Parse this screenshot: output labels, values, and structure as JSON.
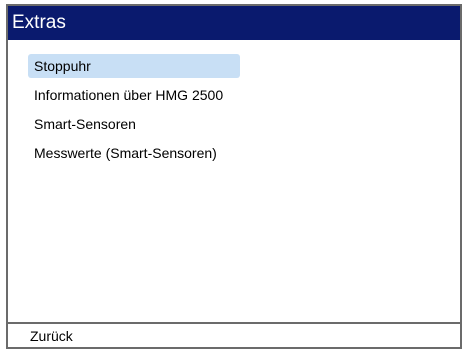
{
  "window": {
    "title": "Extras"
  },
  "menu": {
    "items": [
      {
        "label": "Stoppuhr",
        "selected": true
      },
      {
        "label": "Informationen über HMG 2500",
        "selected": false
      },
      {
        "label": "Smart-Sensoren",
        "selected": false
      },
      {
        "label": "Messwerte (Smart-Sensoren)",
        "selected": false
      }
    ]
  },
  "footer": {
    "back_label": "Zurück"
  },
  "colors": {
    "titlebar": "#0a1a6e",
    "selection": "#c8dff5",
    "border": "#6b6b6b"
  }
}
